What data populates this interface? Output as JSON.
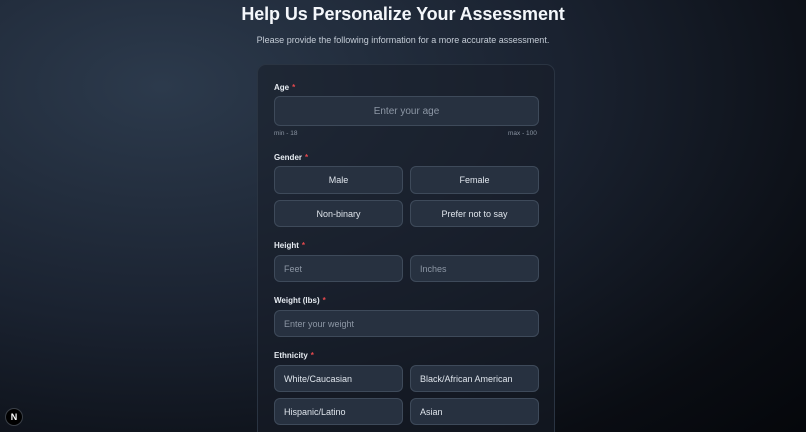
{
  "page": {
    "title": "Help Us Personalize Your Assessment",
    "subtitle": "Please provide the following information for a more accurate assessment."
  },
  "form": {
    "required_marker": "*",
    "age": {
      "label": "Age",
      "placeholder": "Enter your age",
      "value": "",
      "min_hint": "min - 18",
      "max_hint": "max - 100"
    },
    "gender": {
      "label": "Gender",
      "options": [
        "Male",
        "Female",
        "Non-binary",
        "Prefer not to say"
      ]
    },
    "height": {
      "label": "Height",
      "feet_placeholder": "Feet",
      "inches_placeholder": "Inches"
    },
    "weight": {
      "label": "Weight (lbs)",
      "placeholder": "Enter your weight"
    },
    "ethnicity": {
      "label": "Ethnicity",
      "options": [
        "White/Caucasian",
        "Black/African American",
        "Hispanic/Latino",
        "Asian"
      ]
    }
  },
  "devtools": {
    "logo_letter": "N"
  }
}
